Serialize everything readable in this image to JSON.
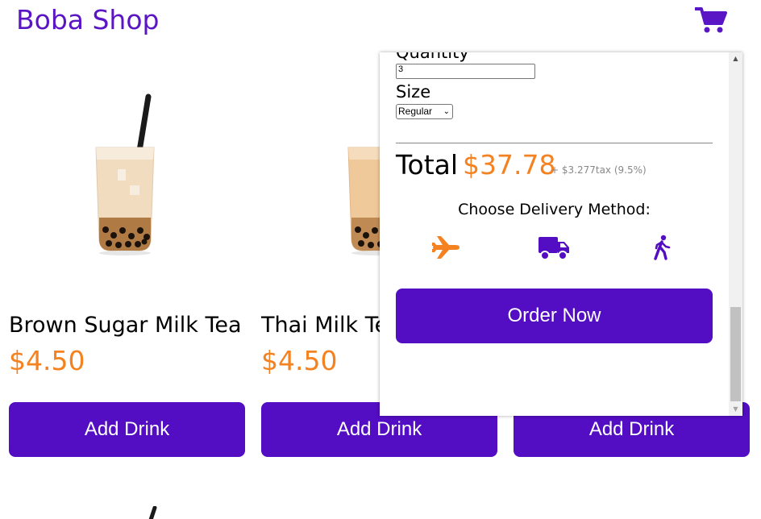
{
  "header": {
    "title": "Boba Shop",
    "cart_icon": "shopping-cart-icon"
  },
  "products": [
    {
      "name": "Brown Sugar Milk Tea",
      "price": "$4.50",
      "button": "Add Drink"
    },
    {
      "name": "Thai Milk Tea",
      "price": "$4.50",
      "button": "Add Drink"
    },
    {
      "name": "",
      "price": "",
      "button": "Add Drink"
    }
  ],
  "cart": {
    "quantity_label": "Quantity",
    "quantity_value": "3",
    "size_label": "Size",
    "size_selected": "Regular",
    "total_label": "Total",
    "total_amount": "$37.78",
    "tax_note": "+ $3.277tax (9.5%)",
    "delivery_label": "Choose Delivery Method:",
    "delivery_icons": [
      "airplane-icon",
      "truck-icon",
      "walking-icon"
    ],
    "order_button": "Order Now"
  },
  "colors": {
    "brand": "#530dc2",
    "price": "#f58220"
  }
}
